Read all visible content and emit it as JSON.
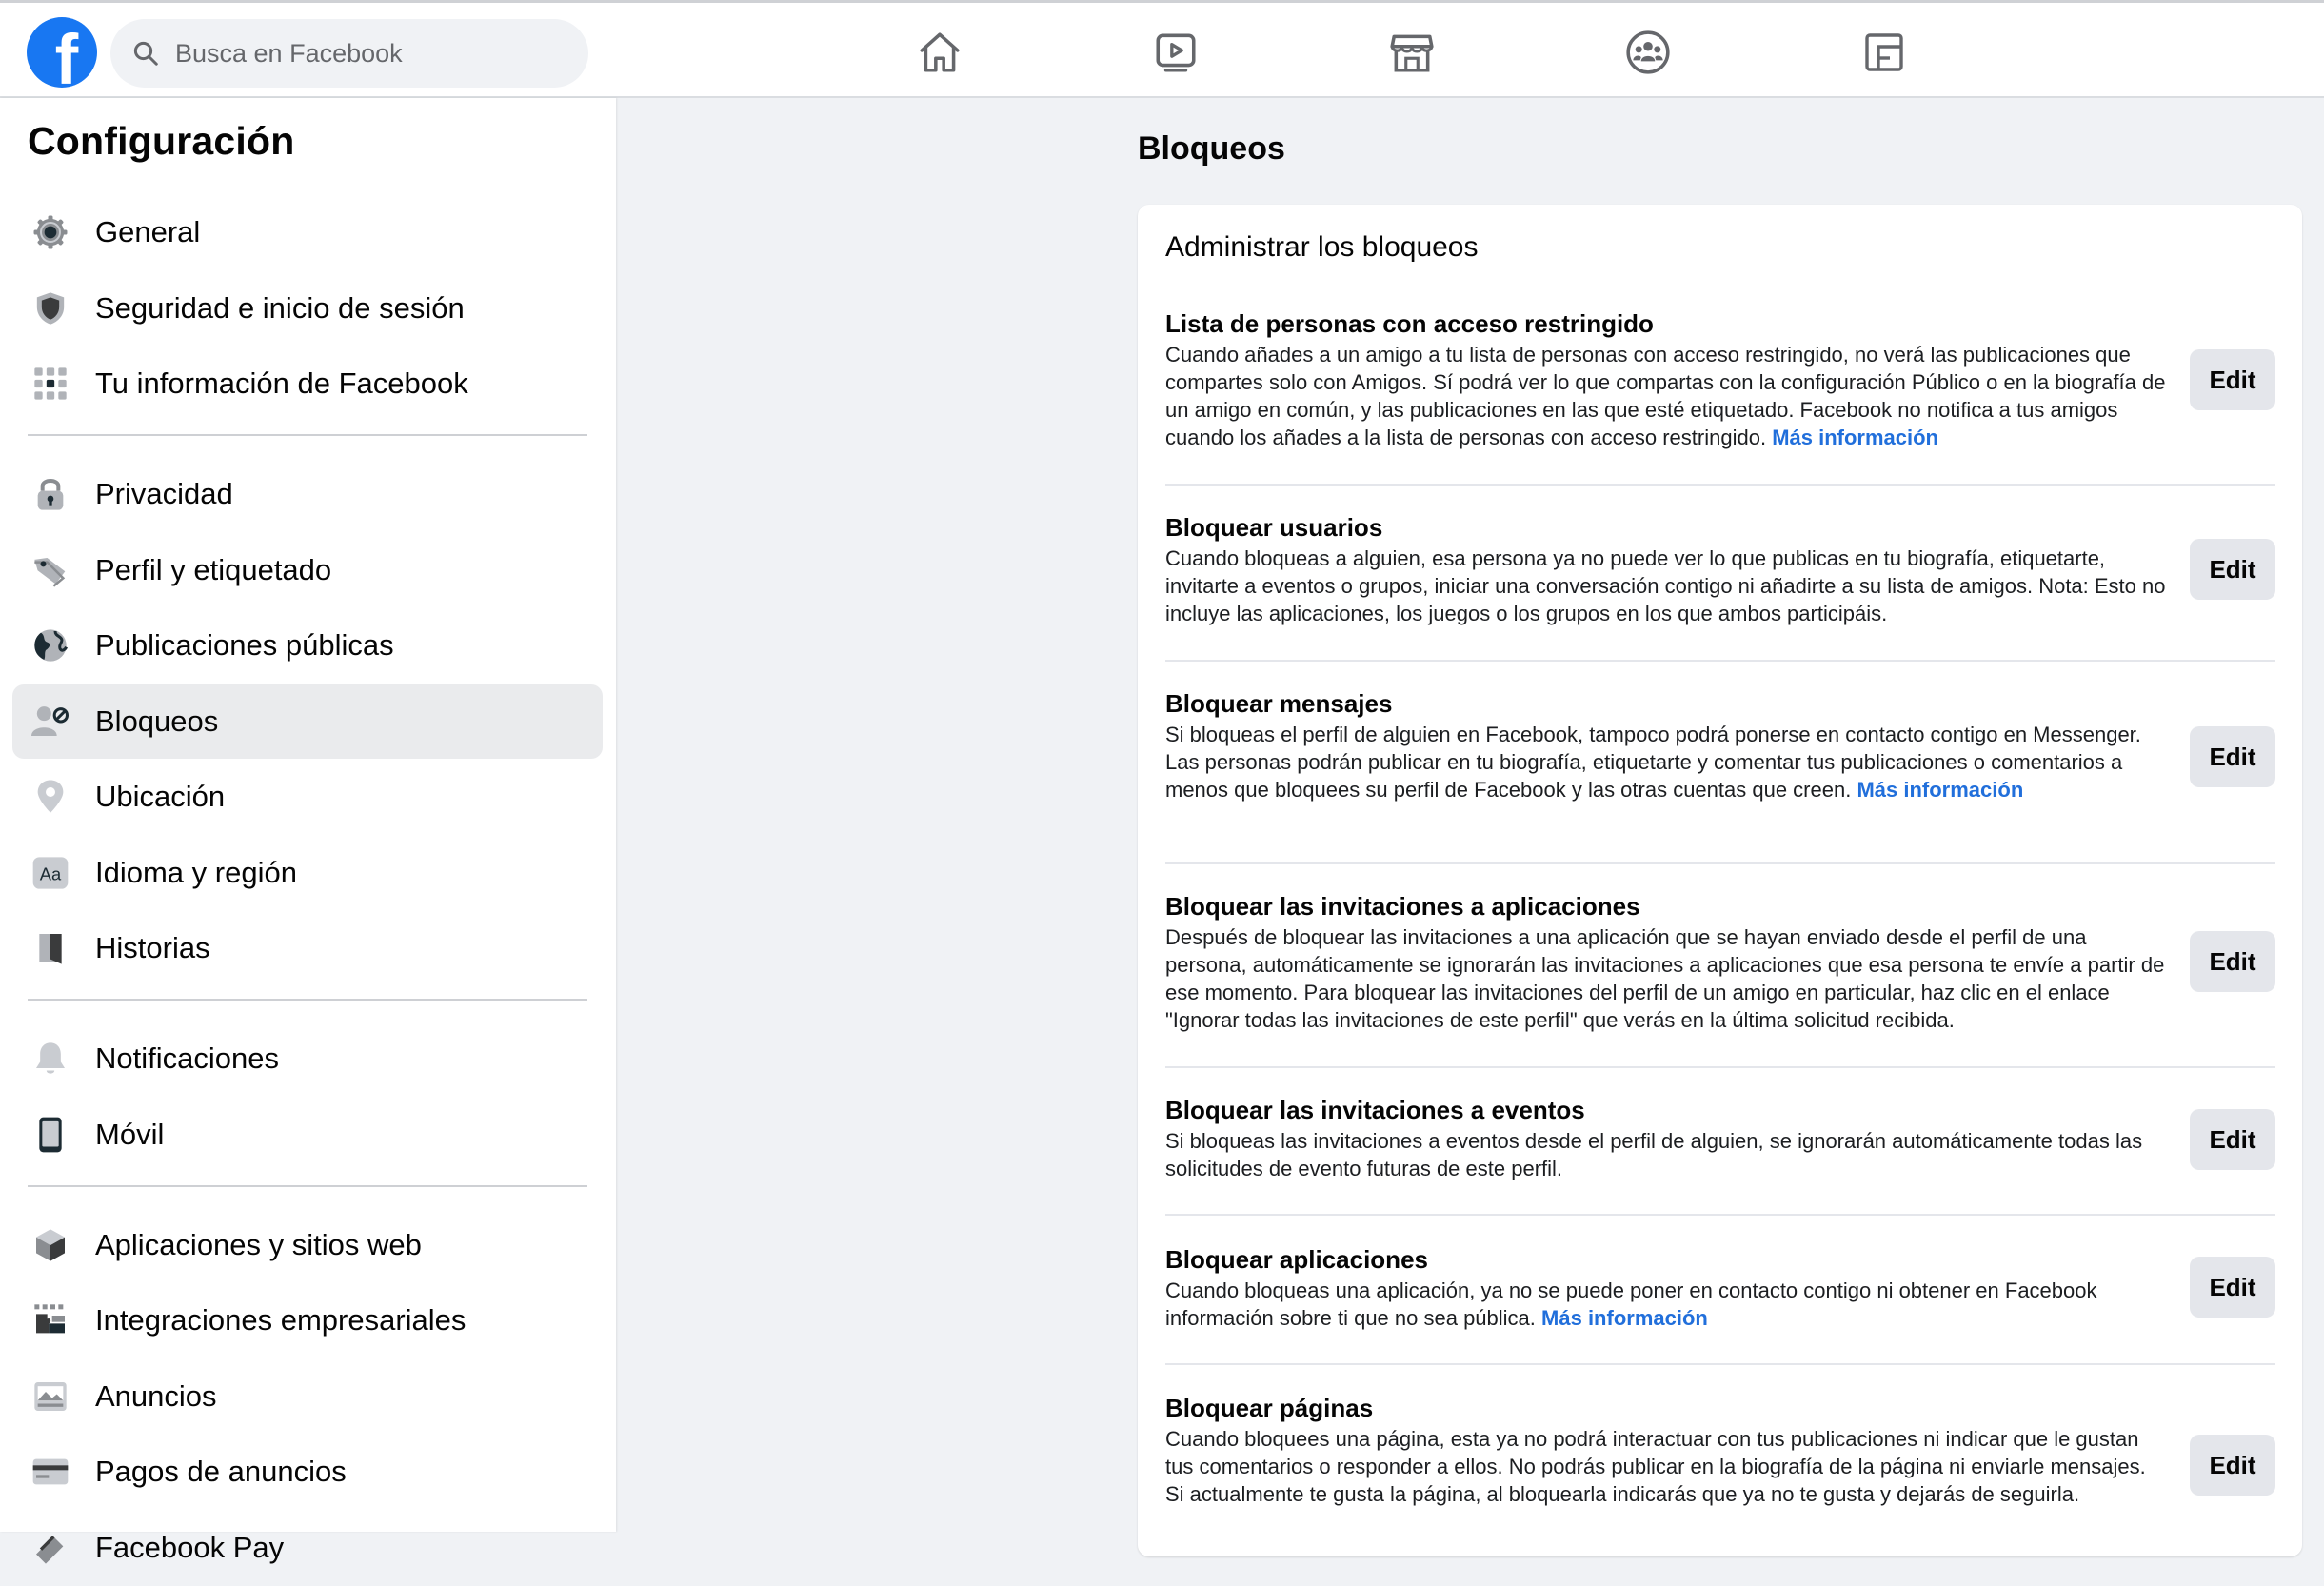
{
  "header": {
    "logo_letter": "f",
    "search_placeholder": "Busca en Facebook",
    "nav_icons": [
      "home-icon",
      "watch-icon",
      "marketplace-icon",
      "groups-icon",
      "gaming-icon"
    ]
  },
  "sidebar": {
    "title": "Configuración",
    "groups": [
      [
        {
          "label": "General",
          "icon": "gear-icon"
        },
        {
          "label": "Seguridad e inicio de sesión",
          "icon": "shield-icon"
        },
        {
          "label": "Tu información de Facebook",
          "icon": "grid-icon"
        }
      ],
      [
        {
          "label": "Privacidad",
          "icon": "lock-icon"
        },
        {
          "label": "Perfil y etiquetado",
          "icon": "tag-icon"
        },
        {
          "label": "Publicaciones públicas",
          "icon": "globe-icon"
        },
        {
          "label": "Bloqueos",
          "icon": "block-user-icon",
          "active": true
        },
        {
          "label": "Ubicación",
          "icon": "location-pin-icon"
        },
        {
          "label": "Idioma y región",
          "icon": "language-icon"
        },
        {
          "label": "Historias",
          "icon": "book-icon"
        }
      ],
      [
        {
          "label": "Notificaciones",
          "icon": "bell-icon"
        },
        {
          "label": "Móvil",
          "icon": "phone-icon"
        }
      ],
      [
        {
          "label": "Aplicaciones y sitios web",
          "icon": "cube-icon"
        },
        {
          "label": "Integraciones empresariales",
          "icon": "puzzle-icon"
        },
        {
          "label": "Anuncios",
          "icon": "ad-icon"
        },
        {
          "label": "Pagos de anuncios",
          "icon": "card-icon"
        },
        {
          "label": "Facebook Pay",
          "icon": "pay-icon"
        }
      ]
    ]
  },
  "main": {
    "title": "Bloqueos",
    "card_title": "Administrar los bloqueos",
    "edit_label": "Edit",
    "sections": [
      {
        "title": "Lista de personas con acceso restringido",
        "body": "Cuando añades a un amigo a tu lista de personas con acceso restringido, no verá las publicaciones que compartes solo con Amigos. Sí podrá ver lo que compartas con la configuración Público o en la biografía de un amigo en común, y las publicaciones en las que esté etiquetado. Facebook no notifica a tus amigos cuando los añades a la lista de personas con acceso restringido.",
        "link": "Más información"
      },
      {
        "title": "Bloquear usuarios",
        "body": "Cuando bloqueas a alguien, esa persona ya no puede ver lo que publicas en tu biografía, etiquetarte, invitarte a eventos o grupos, iniciar una conversación contigo ni añadirte a su lista de amigos. Nota: Esto no incluye las aplicaciones, los juegos o los grupos en los que ambos participáis.",
        "link": ""
      },
      {
        "title": "Bloquear mensajes",
        "body": "Si bloqueas el perfil de alguien en Facebook, tampoco podrá ponerse en contacto contigo en Messenger. Las personas podrán publicar en tu biografía, etiquetarte y comentar tus publicaciones o comentarios a menos que bloquees su perfil de Facebook y las otras cuentas que creen.",
        "link": "Más información"
      },
      {
        "title": "Bloquear las invitaciones a aplicaciones",
        "body": "Después de bloquear las invitaciones a una aplicación que se hayan enviado desde el perfil de una persona, automáticamente se ignorarán las invitaciones a aplicaciones que esa persona te envíe a partir de ese momento. Para bloquear las invitaciones del perfil de un amigo en particular, haz clic en el enlace \"Ignorar todas las invitaciones de este perfil\" que verás en la última solicitud recibida.",
        "link": ""
      },
      {
        "title": "Bloquear las invitaciones a eventos",
        "body": "Si bloqueas las invitaciones a eventos desde el perfil de alguien, se ignorarán automáticamente todas las solicitudes de evento futuras de este perfil.",
        "link": ""
      },
      {
        "title": "Bloquear aplicaciones",
        "body": "Cuando bloqueas una aplicación, ya no se puede poner en contacto contigo ni obtener en Facebook información sobre ti que no sea pública.",
        "link": "Más información"
      },
      {
        "title": "Bloquear páginas",
        "body": "Cuando bloquees una página, esta ya no podrá interactuar con tus publicaciones ni indicar que le gustan tus comentarios o responder a ellos. No podrás publicar en la biografía de la página ni enviarle mensajes. Si actualmente te gusta la página, al bloquearla indicarás que ya no te gusta y dejarás de seguirla.",
        "link": ""
      }
    ]
  }
}
